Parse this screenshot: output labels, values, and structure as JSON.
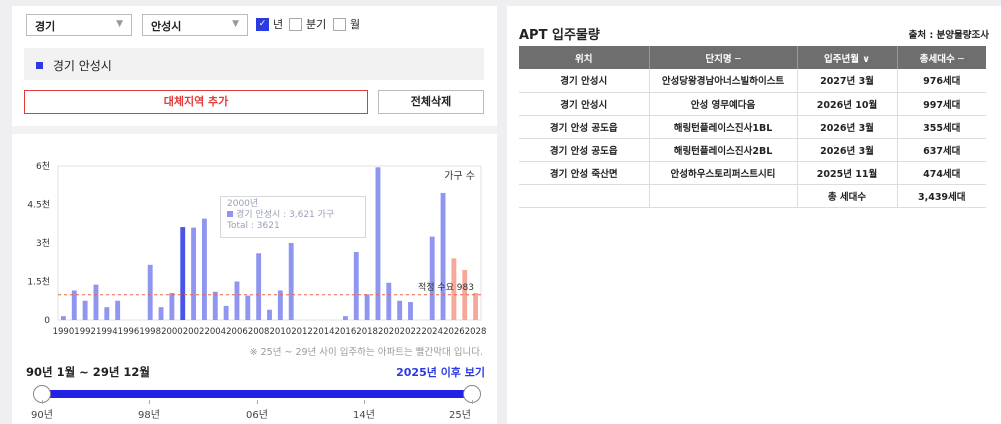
{
  "filters": {
    "province": "경기",
    "city": "안성시",
    "period_options": [
      {
        "label": "년",
        "checked": true
      },
      {
        "label": "분기",
        "checked": false
      },
      {
        "label": "월",
        "checked": false
      }
    ]
  },
  "region_list": [
    "경기 안성시"
  ],
  "buttons": {
    "add_compare": "대체지역 추가",
    "delete_all": "전체삭제"
  },
  "chart_data": {
    "type": "bar",
    "ylabel": "가구 수",
    "ylim": [
      0,
      6000
    ],
    "yticks": [
      {
        "v": 0,
        "label": "0"
      },
      {
        "v": 1500,
        "label": "1.5천"
      },
      {
        "v": 3000,
        "label": "3천"
      },
      {
        "v": 4500,
        "label": "4.5천"
      },
      {
        "v": 6000,
        "label": "6천"
      }
    ],
    "x_tick_labels": [
      "1990",
      "1992",
      "1994",
      "1996",
      "1998",
      "2000",
      "2002",
      "2004",
      "2006",
      "2008",
      "2010",
      "2012",
      "2014",
      "2016",
      "2018",
      "2020",
      "2022",
      "2024",
      "2026",
      "2028"
    ],
    "reference_line": {
      "label": "적정 수요 983",
      "value": 983
    },
    "colors": {
      "actual": "#8f96f0",
      "highlight": "#4b55e3",
      "forecast": "#f5a99a",
      "reference": "#e8604c"
    },
    "series": [
      {
        "values": [
          {
            "year": 1990,
            "v": 150
          },
          {
            "year": 1991,
            "v": 1150
          },
          {
            "year": 1992,
            "v": 750
          },
          {
            "year": 1993,
            "v": 1380
          },
          {
            "year": 1994,
            "v": 500
          },
          {
            "year": 1995,
            "v": 750
          },
          {
            "year": 1998,
            "v": 2150
          },
          {
            "year": 1999,
            "v": 500
          },
          {
            "year": 2000,
            "v": 1050
          },
          {
            "year": 2001,
            "v": 3621,
            "highlight": true
          },
          {
            "year": 2002,
            "v": 3600
          },
          {
            "year": 2003,
            "v": 3950
          },
          {
            "year": 2004,
            "v": 1100
          },
          {
            "year": 2005,
            "v": 550
          },
          {
            "year": 2006,
            "v": 1500
          },
          {
            "year": 2007,
            "v": 950
          },
          {
            "year": 2008,
            "v": 2600
          },
          {
            "year": 2009,
            "v": 400
          },
          {
            "year": 2010,
            "v": 1150
          },
          {
            "year": 2011,
            "v": 3000
          },
          {
            "year": 2016,
            "v": 150
          },
          {
            "year": 2017,
            "v": 2650
          },
          {
            "year": 2018,
            "v": 1000
          },
          {
            "year": 2019,
            "v": 5950
          },
          {
            "year": 2020,
            "v": 1450
          },
          {
            "year": 2021,
            "v": 750
          },
          {
            "year": 2022,
            "v": 700
          },
          {
            "year": 2024,
            "v": 3250
          },
          {
            "year": 2025,
            "v": 4950
          },
          {
            "year": 2026,
            "v": 2400,
            "forecast": true
          },
          {
            "year": 2027,
            "v": 1950,
            "forecast": true
          },
          {
            "year": 2028,
            "v": 1050,
            "forecast": true
          }
        ]
      }
    ]
  },
  "tooltip": {
    "year": "2000년",
    "line": "경기 안성시 : 3,621 가구",
    "total": "Total : 3621"
  },
  "note": "※ 25년 ~ 29년 사이 입주하는 아파트는 빨간막대 입니다.",
  "range": {
    "title": "90년 1월 ~ 29년 12월",
    "link": "2025년 이후 보기",
    "ticks": [
      "90년",
      "98년",
      "06년",
      "14년",
      "25년"
    ],
    "start": 0,
    "end": 1
  },
  "apt": {
    "title": "APT 입주물량",
    "source": "출처 : 분양물량조사",
    "columns": [
      "위치",
      "단지명 ─",
      "입주년월 ∨",
      "총세대수 ─"
    ],
    "rows": [
      [
        "경기 안성시",
        "안성당왕경남아너스빌하이스트",
        "2027년 3월",
        "976세대"
      ],
      [
        "경기 안성시",
        "안성 영무예다음",
        "2026년 10월",
        "997세대"
      ],
      [
        "경기 안성 공도읍",
        "해링턴플레이스진사1BL",
        "2026년 3월",
        "355세대"
      ],
      [
        "경기 안성 공도읍",
        "해링턴플레이스진사2BL",
        "2026년 3월",
        "637세대"
      ],
      [
        "경기 안성 죽산면",
        "안성하우스토리퍼스트시티",
        "2025년 11월",
        "474세대"
      ]
    ],
    "total_label": "총 세대수",
    "total_value": "3,439세대"
  }
}
